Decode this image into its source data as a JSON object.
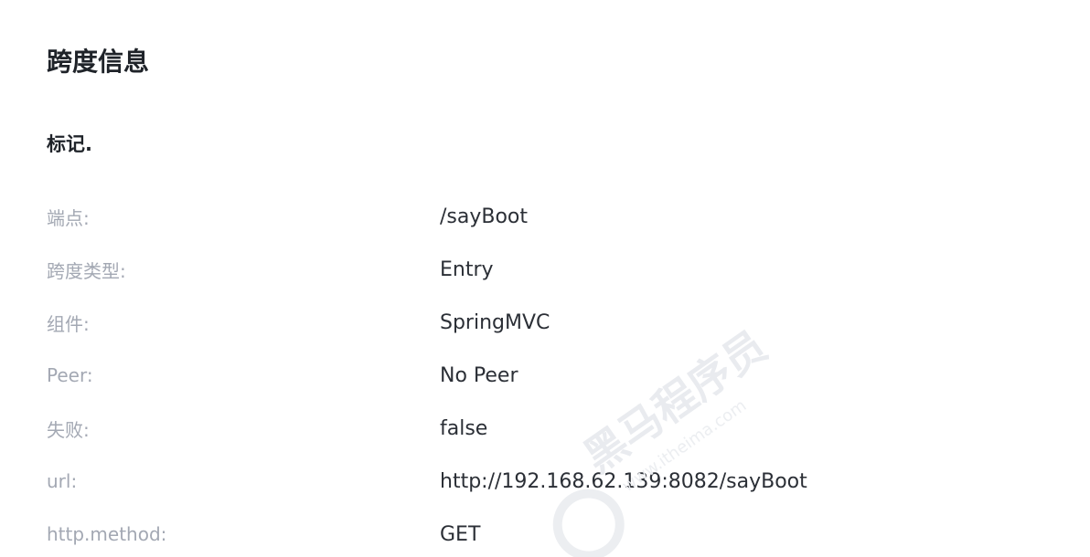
{
  "section": {
    "title": "跨度信息",
    "subtitle": "标记."
  },
  "tags": [
    {
      "key": "端点:",
      "value": "/sayBoot"
    },
    {
      "key": "跨度类型:",
      "value": "Entry"
    },
    {
      "key": "组件:",
      "value": "SpringMVC"
    },
    {
      "key": "Peer:",
      "value": "No Peer"
    },
    {
      "key": "失败:",
      "value": "false"
    },
    {
      "key": "url:",
      "value": "http://192.168.62.139:8082/sayBoot"
    },
    {
      "key": "http.method:",
      "value": "GET"
    }
  ],
  "watermark": {
    "brand_text": "黑马程序员",
    "site_text": "www.itheima.com",
    "color": "#e9ebef"
  }
}
